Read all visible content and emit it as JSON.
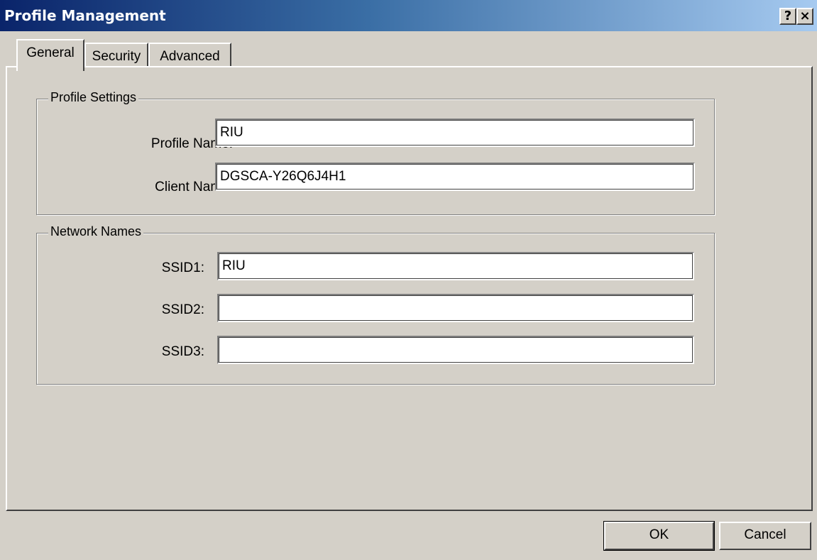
{
  "window": {
    "title": "Profile Management",
    "help_label": "?",
    "close_label": "×",
    "title_gradient": [
      "#0a246a",
      "#a6caf0"
    ]
  },
  "tabs": [
    {
      "label": "General",
      "active": true
    },
    {
      "label": "Security",
      "active": false
    },
    {
      "label": "Advanced",
      "active": false
    }
  ],
  "profile_settings": {
    "legend": "Profile Settings",
    "profile_name_label": "Profile Name:",
    "profile_name_value": "RIU",
    "client_name_label": "Client Name:",
    "client_name_value": "DGSCA-Y26Q6J4H1"
  },
  "network_names": {
    "legend": "Network Names",
    "ssid1_label": "SSID1:",
    "ssid1_value": "RIU",
    "ssid2_label": "SSID2:",
    "ssid2_value": "",
    "ssid3_label": "SSID3:",
    "ssid3_value": ""
  },
  "buttons": {
    "ok_label": "OK",
    "cancel_label": "Cancel"
  }
}
